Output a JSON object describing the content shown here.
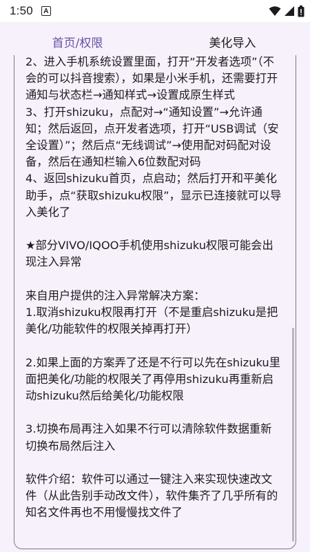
{
  "status_bar": {
    "time": "1:50",
    "notification_icon": "A"
  },
  "tabs": [
    {
      "label": "首页/权限",
      "active": true
    },
    {
      "label": "美化导入",
      "active": false
    }
  ],
  "content": {
    "paragraphs": [
      "2、进入手机系统设置里面，打开“开发者选项”（不会的可以抖音搜索），如果是小米手机，还需要打开通知与状态栏→通知样式→设置成原生样式\n3、打开shizuku，点配对→“通知设置”→允许通知；然后返回，点开发者选项，打开“USB调试（安全设置）”；然后点“无线调试”→使用配对码配对设备，然后在通知栏输入6位数配对码\n4、返回shizuku首页，点启动；然后打开和平美化助手，点“获取shizuku权限”，显示已连接就可以导入美化了",
      "★部分VIVO/IQOO手机使用shizuku权限可能会出现注入异常",
      "来自用户提供的注入异常解决方案：\n1.取消shizuku权限再打开（不是重启shizuku是把美化/功能软件的权限关掉再打开）",
      "2.如果上面的方案弄了还是不行可以先在shizuku里面把美化/功能的权限关了再停用shizuku再重新启动shizuku然后给美化/功能权限",
      "3.切换布局再注入如果不行可以清除软件数据重新切换布局然后注入",
      "软件介绍：软件可以通过一键注入来实现快速改文件（从此告别手动改文件），软件集齐了几乎所有的知名文件再也不用慢慢找文件了"
    ]
  },
  "colors": {
    "accent": "#6750a4",
    "background": "#f7f1fb",
    "text": "#1c1b1f"
  }
}
